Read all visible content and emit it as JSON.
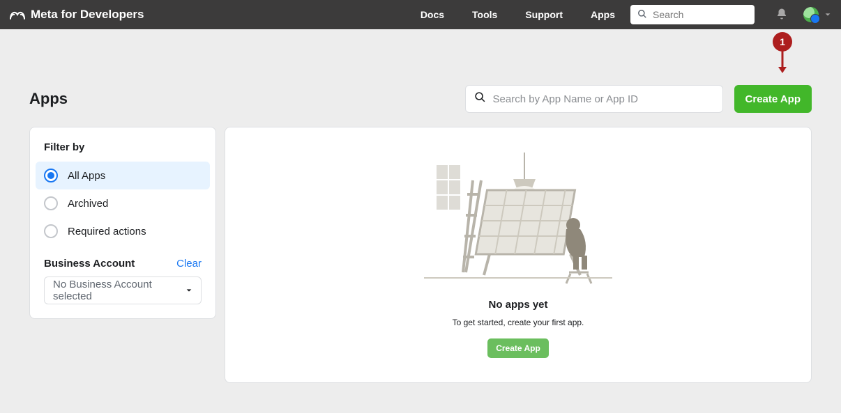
{
  "brand": "Meta for Developers",
  "nav": {
    "items": [
      "Docs",
      "Tools",
      "Support",
      "Apps"
    ],
    "search_placeholder": "Search"
  },
  "annotation": {
    "label": "1"
  },
  "page": {
    "title": "Apps",
    "app_search_placeholder": "Search by App Name or App ID",
    "create_label": "Create App"
  },
  "filter": {
    "heading": "Filter by",
    "options": [
      {
        "label": "All Apps",
        "selected": true
      },
      {
        "label": "Archived",
        "selected": false
      },
      {
        "label": "Required actions",
        "selected": false
      }
    ],
    "biz_heading": "Business Account",
    "clear_label": "Clear",
    "biz_placeholder": "No Business Account selected"
  },
  "empty": {
    "title": "No apps yet",
    "subtitle": "To get started, create your first app.",
    "button_label": "Create App"
  }
}
